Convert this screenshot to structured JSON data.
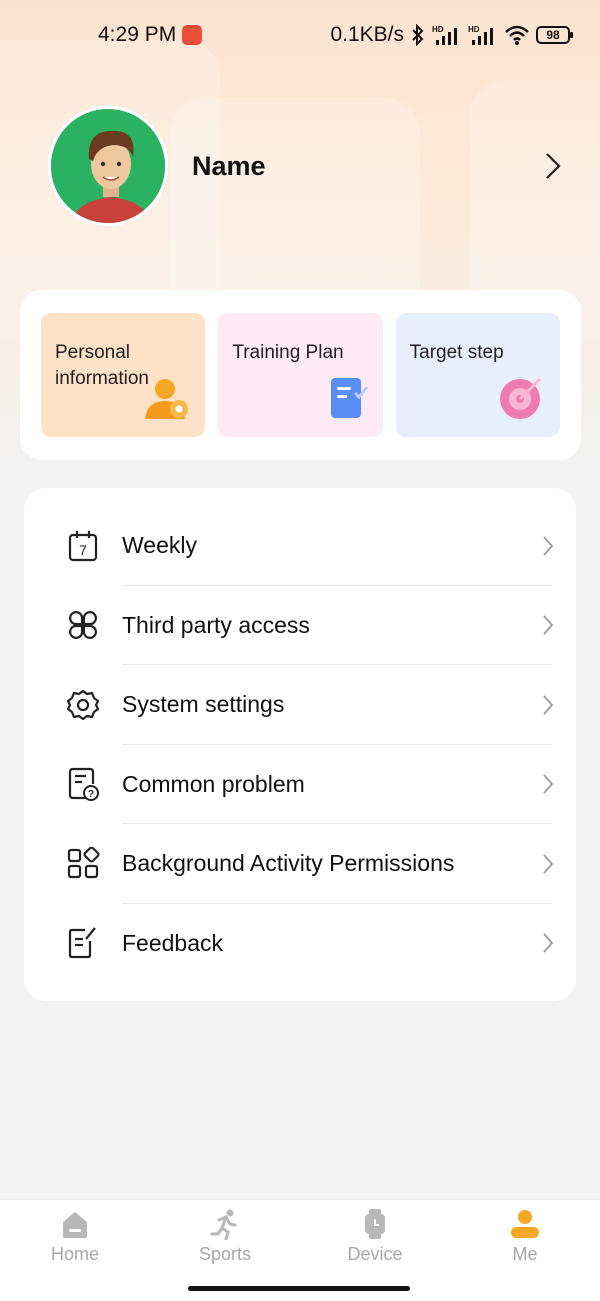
{
  "status_bar": {
    "time": "4:29 PM",
    "net_speed": "0.1KB/s",
    "battery": "98",
    "icons": [
      "app-badge-icon",
      "bluetooth-icon",
      "signal-hd-icon",
      "signal-hd-icon",
      "wifi-icon",
      "battery-icon"
    ]
  },
  "profile": {
    "name": "Name",
    "avatar": "avatar-icon"
  },
  "quick_actions": [
    {
      "label": "Personal information",
      "icon": "person-gear-icon",
      "color": "#fde2c8"
    },
    {
      "label": "Training Plan",
      "icon": "document-icon",
      "color": "#fdeaf4"
    },
    {
      "label": "Target step",
      "icon": "target-icon",
      "color": "#e8effc"
    }
  ],
  "menu": {
    "items": [
      {
        "label": "Weekly",
        "icon": "calendar-7-icon"
      },
      {
        "label": "Third party access",
        "icon": "clover-icon"
      },
      {
        "label": "System settings",
        "icon": "gear-icon"
      },
      {
        "label": "Common problem",
        "icon": "question-doc-icon"
      },
      {
        "label": "Background Activity Permissions",
        "icon": "apps-grid-icon"
      },
      {
        "label": "Feedback",
        "icon": "edit-note-icon"
      }
    ]
  },
  "tab_bar": {
    "tabs": [
      {
        "label": "Home",
        "icon": "home-icon",
        "active": false
      },
      {
        "label": "Sports",
        "icon": "running-icon",
        "active": false
      },
      {
        "label": "Device",
        "icon": "watch-icon",
        "active": false
      },
      {
        "label": "Me",
        "icon": "person-icon",
        "active": true
      }
    ]
  },
  "colors": {
    "accent": "#f5a623",
    "avatar_bg": "#2bb162",
    "tab_inactive": "#a8a8a8"
  }
}
